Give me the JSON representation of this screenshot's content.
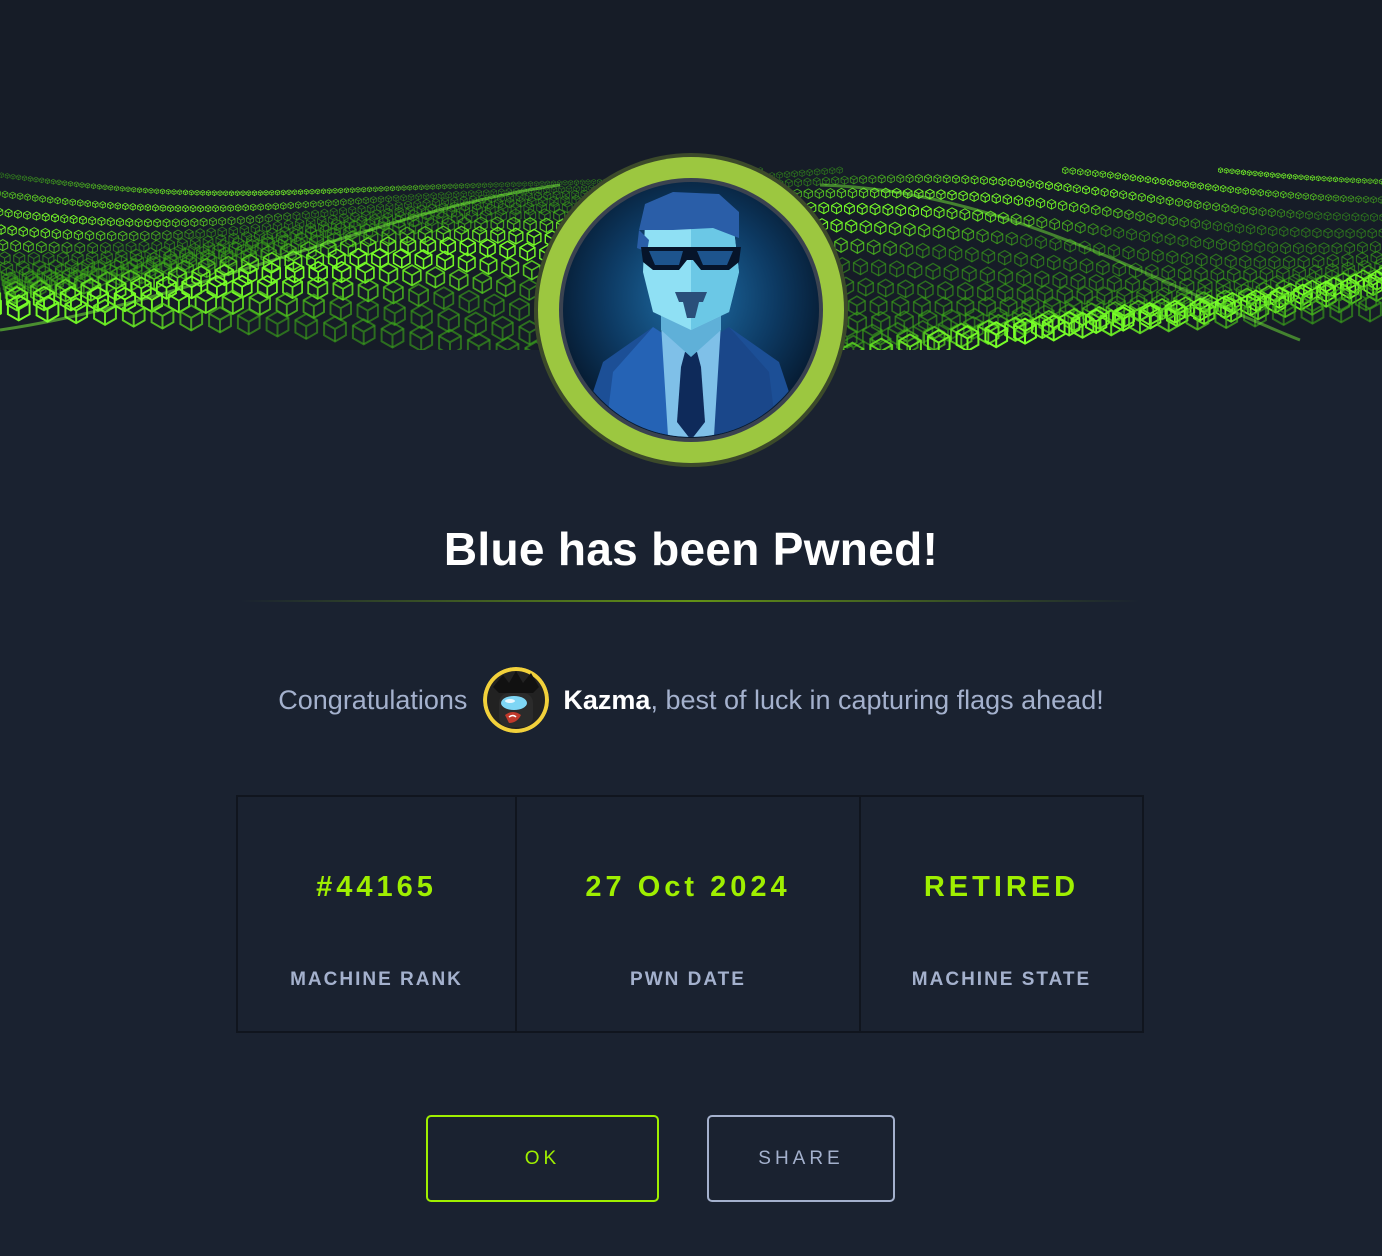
{
  "modal": {
    "title": "Blue has been Pwned!",
    "congrats_prefix": "Congratulations",
    "username": "Kazma",
    "congrats_suffix": ", best of luck in capturing flags ahead!",
    "stats": [
      {
        "value": "#44165",
        "label": "MACHINE RANK"
      },
      {
        "value": "27 Oct 2024",
        "label": "PWN DATE"
      },
      {
        "value": "RETIRED",
        "label": "MACHINE STATE"
      }
    ],
    "ok_label": "OK",
    "share_label": "SHARE"
  },
  "colors": {
    "background": "#1a2230",
    "accent": "#9fef00",
    "muted_text": "#a4b1cd",
    "machine_ring": "#9cc740"
  },
  "icons": {
    "machine_avatar": "agent-with-sunglasses",
    "user_avatar": "among-us-character"
  }
}
